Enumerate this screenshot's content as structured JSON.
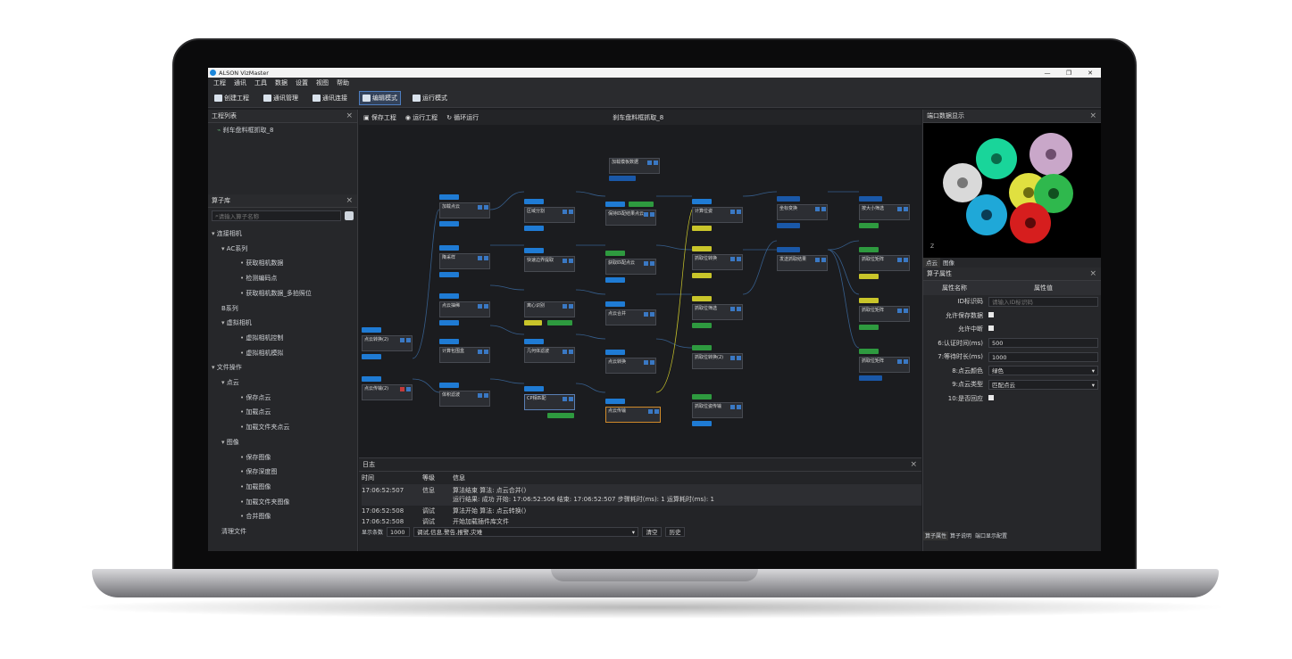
{
  "window": {
    "title": "ALSON VizMaster",
    "controls": [
      "—",
      "❐",
      "✕"
    ]
  },
  "menu": [
    "工程",
    "通讯",
    "工具",
    "数据",
    "设置",
    "视图",
    "帮助"
  ],
  "toolbar": {
    "create": "创建工程",
    "comm_mgr": "通讯管理",
    "comm_conn": "通讯连接",
    "edit_mode": "编辑模式",
    "run_mode": "运行模式"
  },
  "project_list": {
    "title": "工程列表",
    "items": [
      "刹车盘料框抓取_8"
    ]
  },
  "operator_lib": {
    "title": "算子库",
    "search_placeholder": "请输入算子名称",
    "tree": [
      {
        "label": "连接相机",
        "level": 0,
        "arrow": true
      },
      {
        "label": "AC系列",
        "level": 1,
        "arrow": true
      },
      {
        "label": "获取相机数据",
        "level": 2
      },
      {
        "label": "检测编码点",
        "level": 2
      },
      {
        "label": "获取相机数据_多拍照位",
        "level": 2
      },
      {
        "label": "B系列",
        "level": 1
      },
      {
        "label": "虚拟相机",
        "level": 1,
        "arrow": true
      },
      {
        "label": "虚拟相机控制",
        "level": 2
      },
      {
        "label": "虚拟相机模拟",
        "level": 2
      },
      {
        "label": "文件操作",
        "level": 0,
        "arrow": true
      },
      {
        "label": "点云",
        "level": 1,
        "arrow": true
      },
      {
        "label": "保存点云",
        "level": 2
      },
      {
        "label": "加载点云",
        "level": 2
      },
      {
        "label": "加载文件夹点云",
        "level": 2
      },
      {
        "label": "图像",
        "level": 1,
        "arrow": true
      },
      {
        "label": "保存图像",
        "level": 2
      },
      {
        "label": "保存深度图",
        "level": 2
      },
      {
        "label": "加载图像",
        "level": 2
      },
      {
        "label": "加载文件夹图像",
        "level": 2
      },
      {
        "label": "合并图像",
        "level": 2
      },
      {
        "label": "清理文件",
        "level": 1
      }
    ]
  },
  "canvas": {
    "save": "保存工程",
    "run": "运行工程",
    "loop": "循环运行",
    "title": "刹车盘料框抓取_8"
  },
  "nodes": [
    "加载模板数据",
    "加载点云",
    "点云转换(2)",
    "点云传输(2)",
    "降采样",
    "区域分割",
    "快速边界提取",
    "离心识别",
    "几何体滤波",
    "CP相匹配",
    "点云抽稀",
    "体积滤波",
    "保持匹配结果点云",
    "获取匹配点云",
    "点云合并",
    "点云转换",
    "点云传输",
    "计算包围盒",
    "计算位姿",
    "抓取位转换",
    "抓取位筛选",
    "抓取位转换(2)",
    "抓取位姿传输",
    "坐标变换",
    "按大小筛选",
    "抓取位矩阵",
    "发送抓取结果"
  ],
  "log": {
    "title": "日志",
    "headers": [
      "时间",
      "等级",
      "信息"
    ],
    "rows": [
      {
        "time": "17:06:52:507",
        "level": "信息",
        "msg": "算法结束 算法: 点云合并()",
        "msg2": "运行结果: 成功 开始: 17:06:52:506 结束: 17:06:52:507 步骤耗时(ms): 1      运算耗时(ms): 1"
      },
      {
        "time": "17:06:52:508",
        "level": "调试",
        "msg": "算法开始 算法: 点云转换()",
        "msg2": ""
      },
      {
        "time": "17:06:52:508",
        "level": "调试",
        "msg": "开始加载插件库文件",
        "msg2": ""
      }
    ],
    "count_label": "显示条数",
    "count": "1000",
    "filter": "调试,信息,警告,报警,灾难",
    "clear": "清空",
    "history": "历史"
  },
  "port_display": {
    "title": "端口数据显示",
    "tabs": [
      "点云",
      "图像"
    ]
  },
  "properties": {
    "title": "算子属性",
    "col_name": "属性名称",
    "col_value": "属性值",
    "rows": [
      {
        "k": "ID标识码",
        "v": "请输入ID标识码",
        "type": "input-ph"
      },
      {
        "k": "允许保存数据",
        "v": "",
        "type": "check"
      },
      {
        "k": "允许中断",
        "v": "",
        "type": "check"
      },
      {
        "k": "6:认证时间(ms)",
        "v": "500",
        "type": "input"
      },
      {
        "k": "7:等待时长(ms)",
        "v": "1000",
        "type": "input"
      },
      {
        "k": "8:点云颜色",
        "v": "绿色",
        "type": "select"
      },
      {
        "k": "9:点云类型",
        "v": "匹配点云",
        "type": "select"
      },
      {
        "k": "10:是否回应",
        "v": "",
        "type": "check"
      }
    ],
    "bottom_tabs": [
      "算子属性",
      "算子说明",
      "端口显示配置"
    ]
  }
}
